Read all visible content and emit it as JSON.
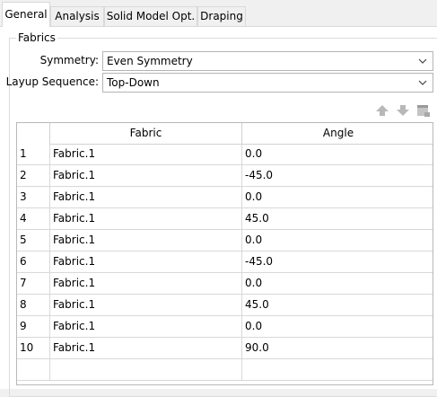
{
  "tabs": [
    {
      "label": "General",
      "active": true
    },
    {
      "label": "Analysis",
      "active": false
    },
    {
      "label": "Solid Model Opt.",
      "active": false
    },
    {
      "label": "Draping",
      "active": false
    }
  ],
  "fabrics_group": {
    "title": "Fabrics",
    "symmetry": {
      "label": "Symmetry:",
      "value": "Even Symmetry"
    },
    "layup_sequence": {
      "label": "Layup Sequence:",
      "value": "Top-Down"
    },
    "toolbar": {
      "move_up_icon": "arrow-up-icon",
      "move_down_icon": "arrow-down-icon",
      "delete_icon": "delete-row-icon"
    },
    "table": {
      "columns": [
        "",
        "Fabric",
        "Angle"
      ],
      "rows": [
        {
          "num": "1",
          "fabric": "Fabric.1",
          "angle": "0.0"
        },
        {
          "num": "2",
          "fabric": "Fabric.1",
          "angle": "-45.0"
        },
        {
          "num": "3",
          "fabric": "Fabric.1",
          "angle": "0.0"
        },
        {
          "num": "4",
          "fabric": "Fabric.1",
          "angle": "45.0"
        },
        {
          "num": "5",
          "fabric": "Fabric.1",
          "angle": "0.0"
        },
        {
          "num": "6",
          "fabric": "Fabric.1",
          "angle": "-45.0"
        },
        {
          "num": "7",
          "fabric": "Fabric.1",
          "angle": "0.0"
        },
        {
          "num": "8",
          "fabric": "Fabric.1",
          "angle": "45.0"
        },
        {
          "num": "9",
          "fabric": "Fabric.1",
          "angle": "0.0"
        },
        {
          "num": "10",
          "fabric": "Fabric.1",
          "angle": "90.0"
        },
        {
          "num": "",
          "fabric": "",
          "angle": ""
        }
      ]
    }
  }
}
